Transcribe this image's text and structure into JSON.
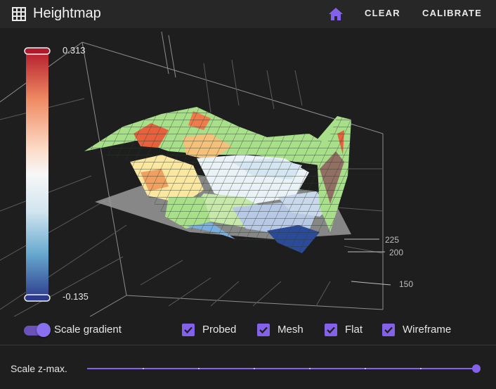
{
  "header": {
    "title": "Heightmap",
    "title_icon": "grid-icon",
    "home_icon": "home-icon",
    "clear_label": "CLEAR",
    "calibrate_label": "CALIBRATE",
    "accent_color": "#8461ea"
  },
  "plot": {
    "scale_max": "0.313",
    "scale_min": "-0.135",
    "axis_ticks": [
      "225",
      "200",
      "150"
    ]
  },
  "controls": {
    "scale_gradient_label": "Scale gradient",
    "scale_gradient_on": true,
    "checkboxes": [
      {
        "label": "Probed",
        "checked": true
      },
      {
        "label": "Mesh",
        "checked": true
      },
      {
        "label": "Flat",
        "checked": true
      },
      {
        "label": "Wireframe",
        "checked": true
      }
    ]
  },
  "slider": {
    "label": "Scale z-max.",
    "value_fraction": 1.0
  }
}
